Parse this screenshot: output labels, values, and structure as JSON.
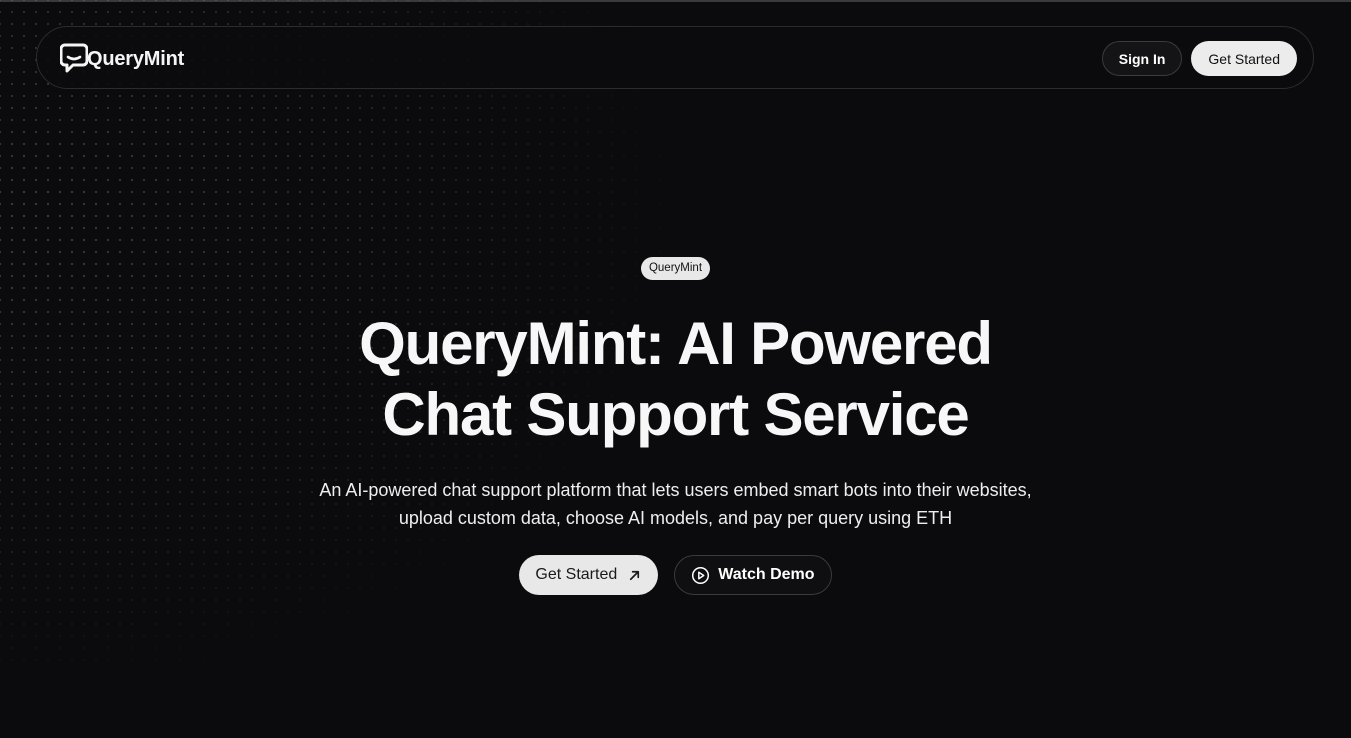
{
  "nav": {
    "brand": "QueryMint",
    "sign_in": "Sign In",
    "get_started": "Get Started"
  },
  "hero": {
    "badge": "QueryMint",
    "title_line1": "QueryMint: AI Powered",
    "title_line2": "Chat Support Service",
    "subtitle_line1": "An AI-powered chat support platform that lets users embed smart bots into their websites,",
    "subtitle_line2": "upload custom data, choose AI models, and pay per query using ETH",
    "cta_primary": "Get Started",
    "cta_secondary": "Watch Demo"
  },
  "icons": {
    "logo": "chat-bubble-icon",
    "cta_primary": "arrow-up-right-icon",
    "cta_secondary": "play-circle-icon"
  },
  "colors": {
    "background": "#0b0b0d",
    "button_light": "#e8e8e8",
    "text": "#f5f5f5"
  }
}
